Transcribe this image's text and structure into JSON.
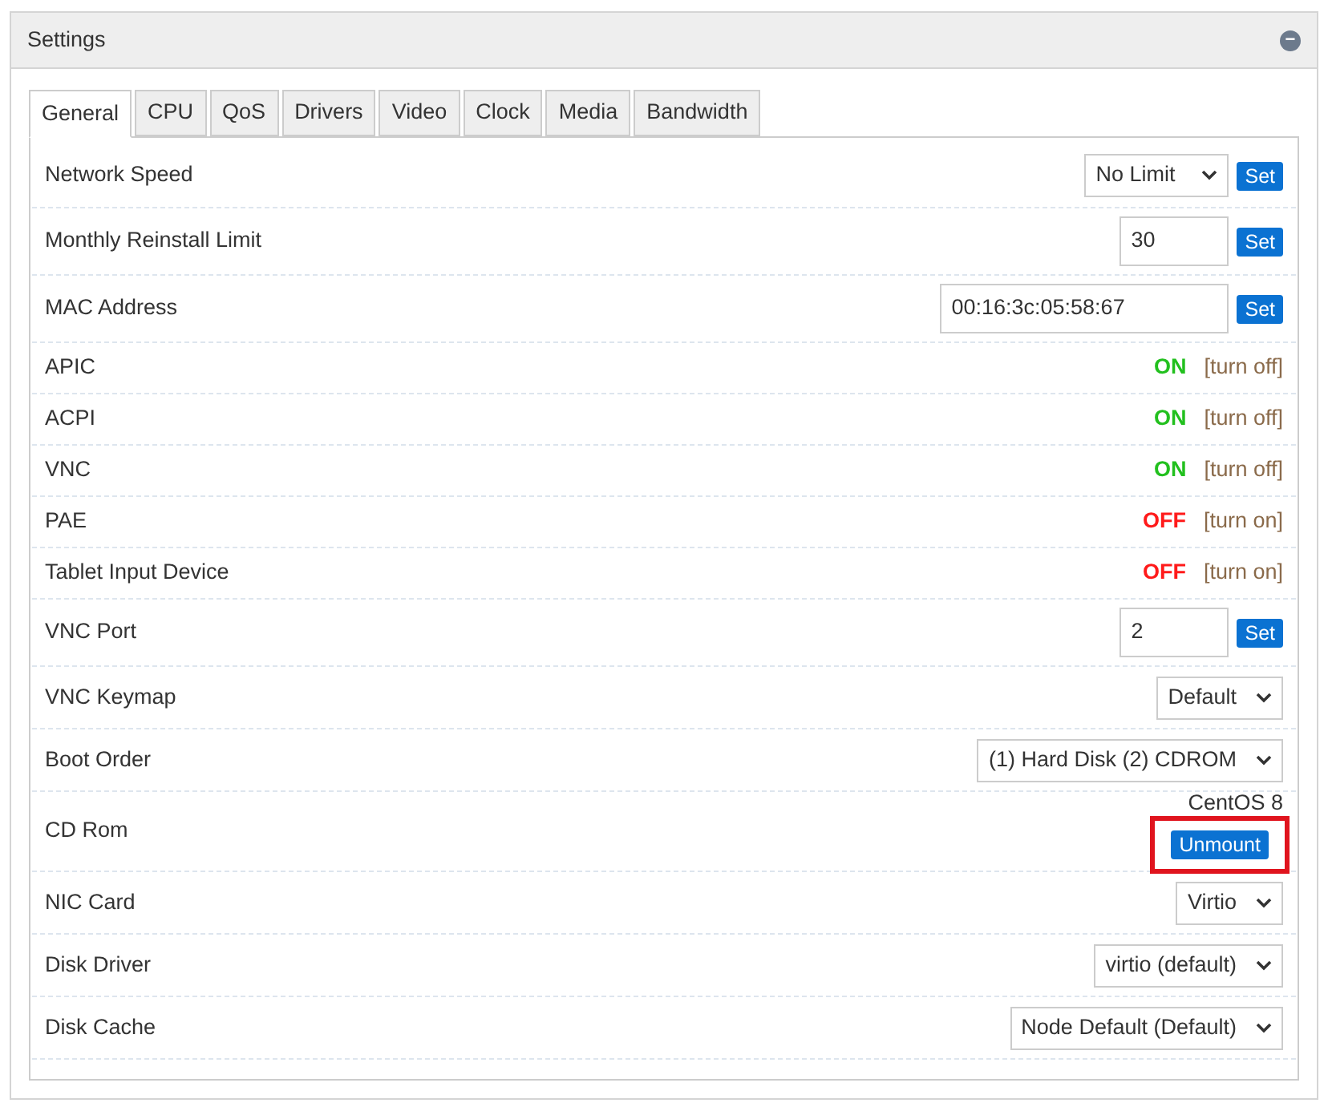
{
  "panel": {
    "title": "Settings",
    "collapse_icon": "−"
  },
  "tabs": [
    {
      "label": "General",
      "selected": true
    },
    {
      "label": "CPU",
      "selected": false
    },
    {
      "label": "QoS",
      "selected": false
    },
    {
      "label": "Drivers",
      "selected": false
    },
    {
      "label": "Video",
      "selected": false
    },
    {
      "label": "Clock",
      "selected": false
    },
    {
      "label": "Media",
      "selected": false
    },
    {
      "label": "Bandwidth",
      "selected": false
    }
  ],
  "rows": [
    {
      "kind": "select_set",
      "label": "Network Speed",
      "value": "No Limit",
      "button": "Set"
    },
    {
      "kind": "input_set",
      "label": "Monthly Reinstall Limit",
      "value": "30",
      "button": "Set",
      "wide": false
    },
    {
      "kind": "input_set",
      "label": "MAC Address",
      "value": "00:16:3c:05:58:67",
      "button": "Set",
      "wide": true
    },
    {
      "kind": "toggle",
      "label": "APIC",
      "on": true,
      "status": "ON",
      "action": "[turn off]"
    },
    {
      "kind": "toggle",
      "label": "ACPI",
      "on": true,
      "status": "ON",
      "action": "[turn off]"
    },
    {
      "kind": "toggle",
      "label": "VNC",
      "on": true,
      "status": "ON",
      "action": "[turn off]"
    },
    {
      "kind": "toggle",
      "label": "PAE",
      "on": false,
      "status": "OFF",
      "action": "[turn on]"
    },
    {
      "kind": "toggle",
      "label": "Tablet Input Device",
      "on": false,
      "status": "OFF",
      "action": "[turn on]"
    },
    {
      "kind": "input_set",
      "label": "VNC Port",
      "value": "2",
      "button": "Set",
      "wide": false
    },
    {
      "kind": "select",
      "label": "VNC Keymap",
      "value": "Default"
    },
    {
      "kind": "select",
      "label": "Boot Order",
      "value": "(1) Hard Disk (2) CDROM"
    },
    {
      "kind": "media",
      "label": "CD Rom",
      "value": "CentOS 8",
      "button": "Unmount",
      "highlighted": true
    },
    {
      "kind": "select",
      "label": "NIC Card",
      "value": "Virtio"
    },
    {
      "kind": "select",
      "label": "Disk Driver",
      "value": "virtio (default)"
    },
    {
      "kind": "select",
      "label": "Disk Cache",
      "value": "Node Default (Default)"
    }
  ]
}
